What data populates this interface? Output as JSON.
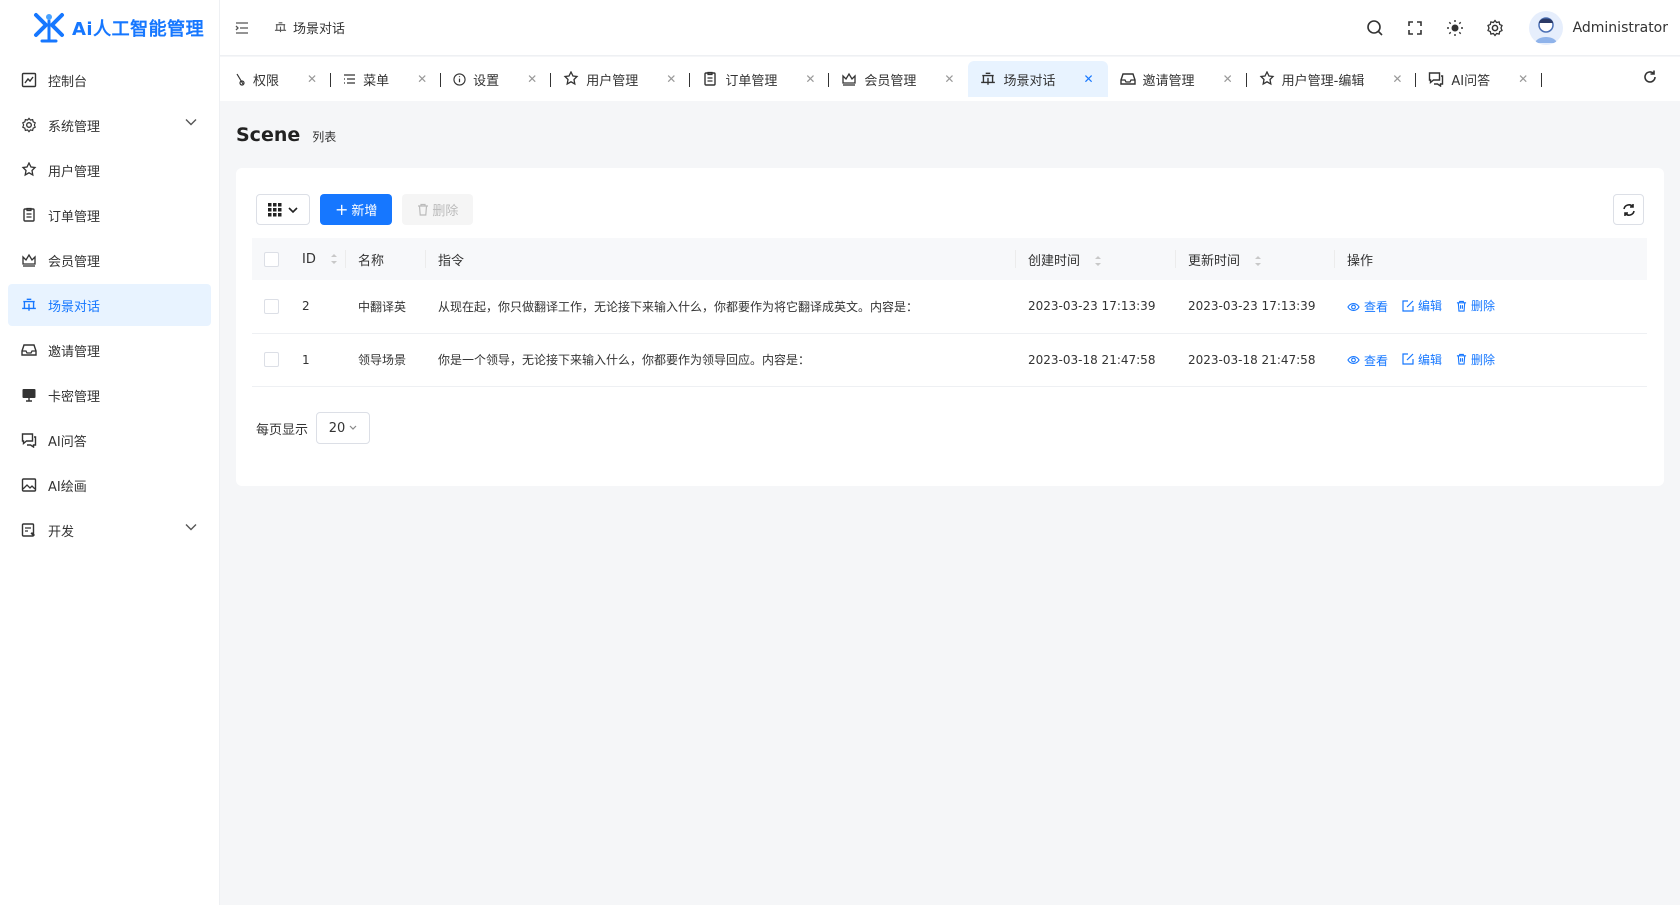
{
  "app": {
    "title": "Ai人工智能管理"
  },
  "sidebar": {
    "items": [
      {
        "label": "控制台",
        "icon": "dashboard-icon",
        "active": false,
        "expandable": false
      },
      {
        "label": "系统管理",
        "icon": "gear-icon",
        "active": false,
        "expandable": true
      },
      {
        "label": "用户管理",
        "icon": "user-icon",
        "active": false,
        "expandable": false
      },
      {
        "label": "订单管理",
        "icon": "order-icon",
        "active": false,
        "expandable": false
      },
      {
        "label": "会员管理",
        "icon": "crown-icon",
        "active": false,
        "expandable": false
      },
      {
        "label": "场景对话",
        "icon": "scene-icon",
        "active": true,
        "expandable": false
      },
      {
        "label": "邀请管理",
        "icon": "inbox-icon",
        "active": false,
        "expandable": false
      },
      {
        "label": "卡密管理",
        "icon": "monitor-icon",
        "active": false,
        "expandable": false
      },
      {
        "label": "AI问答",
        "icon": "chat-icon",
        "active": false,
        "expandable": false
      },
      {
        "label": "AI绘画",
        "icon": "image-icon",
        "active": false,
        "expandable": false
      },
      {
        "label": "开发",
        "icon": "dev-icon",
        "active": false,
        "expandable": true
      }
    ]
  },
  "header": {
    "breadcrumb": "场景对话",
    "username": "Administrator"
  },
  "tabs": [
    {
      "label": "权限",
      "icon": "key-icon",
      "active": false
    },
    {
      "label": "菜单",
      "icon": "menu-icon",
      "active": false
    },
    {
      "label": "设置",
      "icon": "info-icon",
      "active": false
    },
    {
      "label": "用户管理",
      "icon": "user-icon",
      "active": false
    },
    {
      "label": "订单管理",
      "icon": "order-icon",
      "active": false
    },
    {
      "label": "会员管理",
      "icon": "crown-icon",
      "active": false
    },
    {
      "label": "场景对话",
      "icon": "scene-icon",
      "active": true
    },
    {
      "label": "邀请管理",
      "icon": "inbox-icon",
      "active": false
    },
    {
      "label": "用户管理-编辑",
      "icon": "user-icon",
      "active": false
    },
    {
      "label": "AI问答",
      "icon": "chat-icon",
      "active": false
    }
  ],
  "page": {
    "title": "Scene",
    "subtitle": "列表"
  },
  "toolbar": {
    "add_label": "新增",
    "delete_label": "删除"
  },
  "table": {
    "columns": [
      "ID",
      "名称",
      "指令",
      "创建时间",
      "更新时间",
      "操作"
    ],
    "rows": [
      {
        "id": "2",
        "name": "中翻译英",
        "instruction": "从现在起，你只做翻译工作，无论接下来输入什么，你都要作为将它翻译成英文。内容是：",
        "created": "2023-03-23 17:13:39",
        "updated": "2023-03-23 17:13:39"
      },
      {
        "id": "1",
        "name": "领导场景",
        "instruction": "你是一个领导，无论接下来输入什么，你都要作为领导回应。内容是：",
        "created": "2023-03-18 21:47:58",
        "updated": "2023-03-18 21:47:58"
      }
    ],
    "actions": {
      "view": "查看",
      "edit": "编辑",
      "delete": "删除"
    }
  },
  "pager": {
    "label": "每页显示",
    "page_size": "20"
  },
  "colors": {
    "primary": "#1677ff",
    "active_bg": "#e8f3ff"
  }
}
